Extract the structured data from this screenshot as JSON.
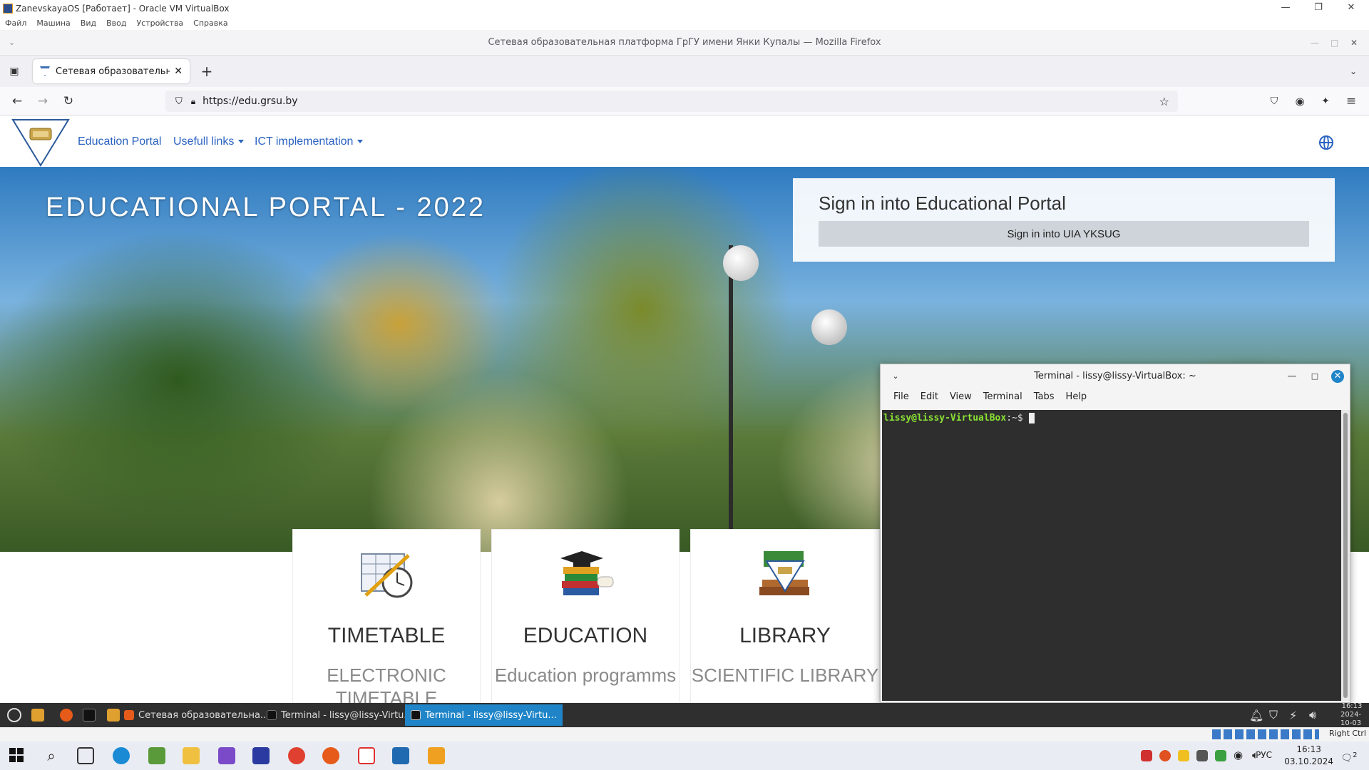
{
  "host": {
    "window_title": "ZanevskayaOS [Работает] - Oracle VM VirtualBox",
    "menu": [
      "Файл",
      "Машина",
      "Вид",
      "Ввод",
      "Устройства",
      "Справка"
    ],
    "host_key": "Right Ctrl"
  },
  "firefox": {
    "window_title": "Сетевая образовательная платформа ГрГУ имени Янки Купалы — Mozilla Firefox",
    "tab_label": "Сетевая образовательная",
    "url": "https://edu.grsu.by"
  },
  "site": {
    "nav": {
      "home": "Education Portal",
      "useful": "Usefull links",
      "ict": "ICT implementation"
    },
    "hero_title": "EDUCATIONAL PORTAL - 2022",
    "signin": {
      "heading": "Sign in into Educational Portal",
      "button": "Sign in into UIA YKSUG"
    },
    "cards": [
      {
        "title": "TIMETABLE",
        "subtitle": "ELECTRONIC TIMETABLE",
        "icon": "timetable-icon"
      },
      {
        "title": "EDUCATION",
        "subtitle": "Education programms",
        "icon": "graduation-books-icon"
      },
      {
        "title": "LIBRARY",
        "subtitle": "SCIENTIFIC LIBRARY",
        "icon": "library-books-icon"
      }
    ]
  },
  "terminal": {
    "title": "Terminal - lissy@lissy-VirtualBox: ~",
    "menu": [
      "File",
      "Edit",
      "View",
      "Terminal",
      "Tabs",
      "Help"
    ],
    "prompt_user": "lissy@lissy-VirtualBox",
    "prompt_path": ":~$"
  },
  "guest_panel": {
    "items": [
      {
        "label": "Сетевая образовательна...",
        "active": false
      },
      {
        "label": "Terminal - lissy@lissy-Virtu...",
        "active": false
      },
      {
        "label": "Terminal - lissy@lissy-Virtu...",
        "active": true
      }
    ],
    "time": "16:13",
    "date": "2024-10-03"
  },
  "windows": {
    "lang": "РУС",
    "time": "16:13",
    "date": "03.10.2024",
    "notif_count": "2"
  },
  "colors": {
    "link_blue": "#2b63c1",
    "panel_active": "#1f85c8",
    "terminal_prompt": "#8ae234"
  }
}
